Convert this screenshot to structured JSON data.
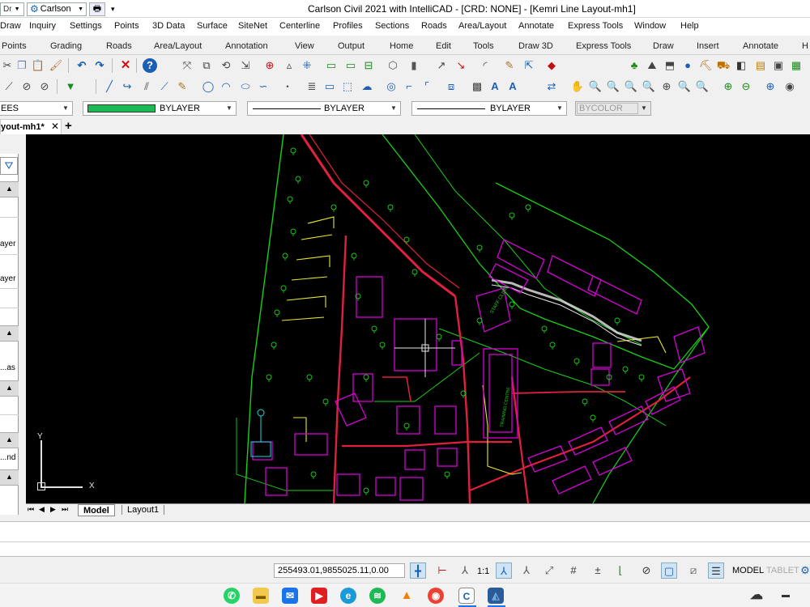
{
  "window": {
    "title": "Carlson Civil 2021 with IntelliCAD - [CRD: NONE] - [Kemri Line Layout-mh1]",
    "app_menu": "Carlson"
  },
  "menu": [
    "Draw",
    "Inquiry",
    "Settings",
    "Points",
    "3D Data",
    "Surface",
    "SiteNet",
    "Centerline",
    "Profiles",
    "Sections",
    "Roads",
    "Area/Layout",
    "Annotate",
    "Express Tools",
    "Window",
    "Help"
  ],
  "ribbon_tabs": [
    "Points",
    "Grading",
    "Roads",
    "Area/Layout",
    "Annotation",
    "View",
    "Output",
    "Home",
    "Edit",
    "Tools",
    "Draw 3D",
    "Express Tools",
    "Draw",
    "Insert",
    "Annotate",
    "H"
  ],
  "properties": {
    "layer": "EES",
    "color": "BYLAYER",
    "linetype": "BYLAYER",
    "lineweight": "BYLAYER",
    "plotstyle": "BYCOLOR",
    "color_swatch": "#1db954"
  },
  "document_tab": "yout-mh1*",
  "palette_rows": [
    "ayer",
    "ayer",
    "as...",
    "nd..."
  ],
  "layout_tabs": [
    "Model",
    "Layout1"
  ],
  "ucs": {
    "x": "X",
    "y": "Y"
  },
  "status": {
    "coordinates": "255493.01,9855025.11,0.00",
    "scale": "1:1",
    "model": "MODEL",
    "tablet": "TABLET"
  },
  "drawing": {
    "colors": {
      "road": "#e0203c",
      "building": "#d400d4",
      "green": "#16d016",
      "white": "#e8e8e8",
      "yellow": "#e8e82a",
      "cyan": "#19d9e0"
    },
    "labels": [
      "STAFF CLINIC",
      "TRAINING CENTRE"
    ]
  },
  "taskbar": [
    "whatsapp",
    "file-explorer",
    "mail",
    "youtube",
    "edge",
    "spotify",
    "vlc",
    "chrome",
    "carlson",
    "intellicad",
    "cloud"
  ]
}
